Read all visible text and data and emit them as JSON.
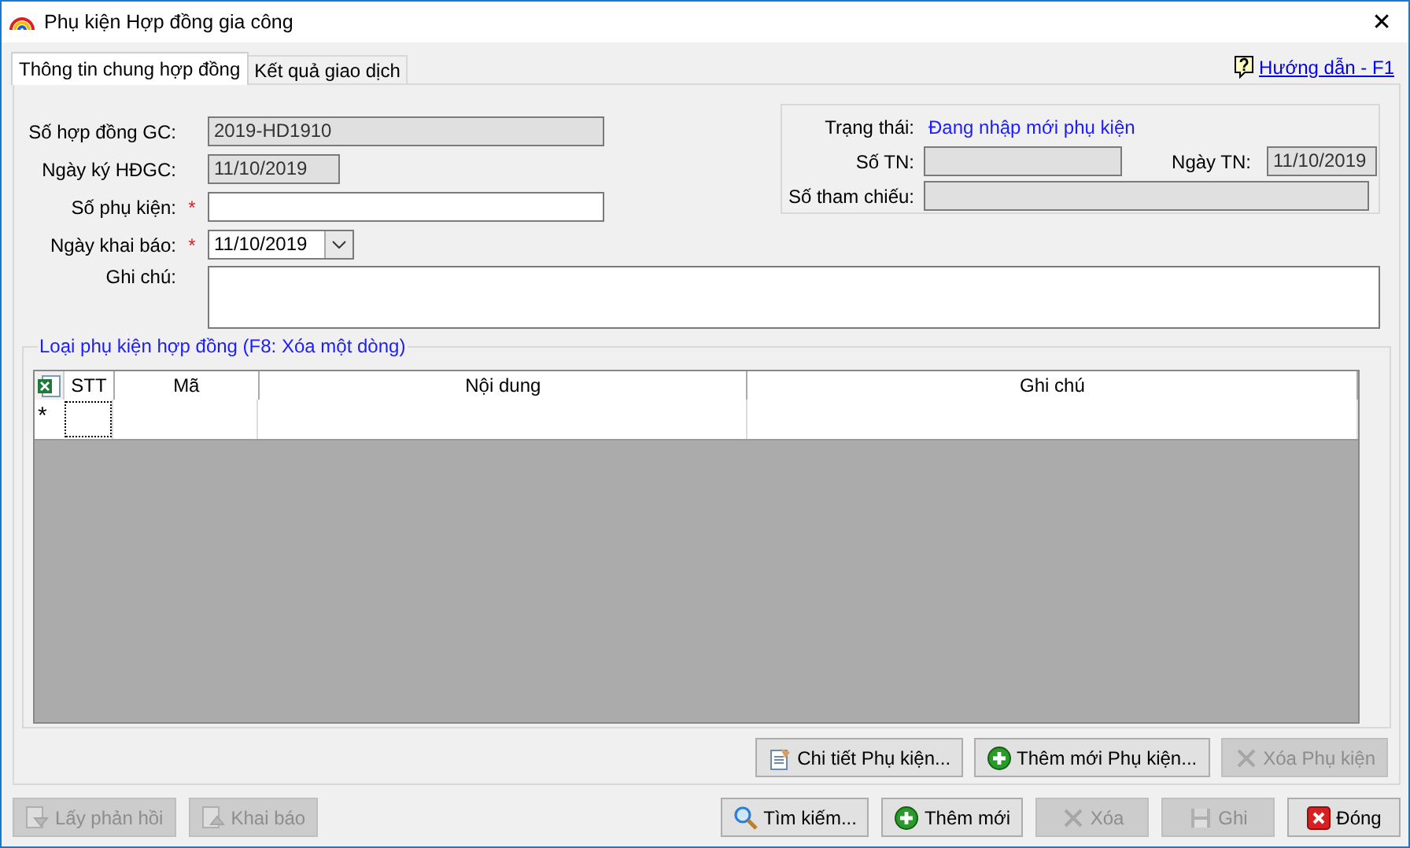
{
  "window": {
    "title": "Phụ kiện Hợp đồng gia công",
    "close": "✕"
  },
  "help_link": "Hướng dẫn - F1",
  "tabs": [
    {
      "label": "Thông tin chung hợp đồng",
      "selected": true
    },
    {
      "label": "Kết quả giao dịch",
      "selected": false
    }
  ],
  "fields": [
    {
      "label": "Số hợp đồng GC:",
      "value": "2019-HD1910",
      "required": false,
      "disabled": true,
      "kind": "wide"
    },
    {
      "label": "Ngày ký HĐGC:",
      "value": "11/10/2019",
      "required": false,
      "disabled": true,
      "kind": "date"
    },
    {
      "label": "Số phụ kiện:",
      "required": true,
      "disabled": false,
      "kind": "wide"
    },
    {
      "label": "Ngày khai báo:",
      "value": "11/10/2019",
      "required": true,
      "disabled": false,
      "kind": "datepicker"
    }
  ],
  "note": {
    "label": "Ghi chú:"
  },
  "status_panel": {
    "status_label": "Trạng thái:",
    "status_value": "Đang nhập mới phụ kiện",
    "so_tn": {
      "label": "Số TN:"
    },
    "ngay_tn": {
      "label": "Ngày TN:",
      "value": "11/10/2019"
    },
    "so_tham_chieu": {
      "label": "Số tham chiếu:"
    }
  },
  "grid": {
    "title": "Loại phụ kiện hợp đồng (F8: Xóa một dòng)",
    "columns": [
      "STT",
      "Mã",
      "Nội dung",
      "Ghi chú"
    ],
    "new_row_marker": "*"
  },
  "grid_buttons": [
    {
      "label": "Chi tiết Phụ kiện...",
      "kind": "detail",
      "disabled": false
    },
    {
      "label": "Thêm mới Phụ kiện...",
      "kind": "add",
      "disabled": false
    },
    {
      "label": "Xóa Phụ kiện",
      "kind": "delete",
      "disabled": true
    }
  ],
  "footer_left_buttons": [
    {
      "label": "Lấy phản hồi",
      "kind": "receive",
      "disabled": true
    },
    {
      "label": "Khai báo",
      "kind": "send",
      "disabled": true
    }
  ],
  "footer_buttons": [
    {
      "label": "Tìm kiếm...",
      "kind": "search",
      "disabled": false
    },
    {
      "label": "Thêm mới",
      "kind": "add",
      "disabled": false
    },
    {
      "label": "Xóa",
      "kind": "delete",
      "disabled": true
    },
    {
      "label": "Ghi",
      "kind": "save",
      "disabled": true
    },
    {
      "label": "Đóng",
      "kind": "close",
      "disabled": false
    }
  ]
}
